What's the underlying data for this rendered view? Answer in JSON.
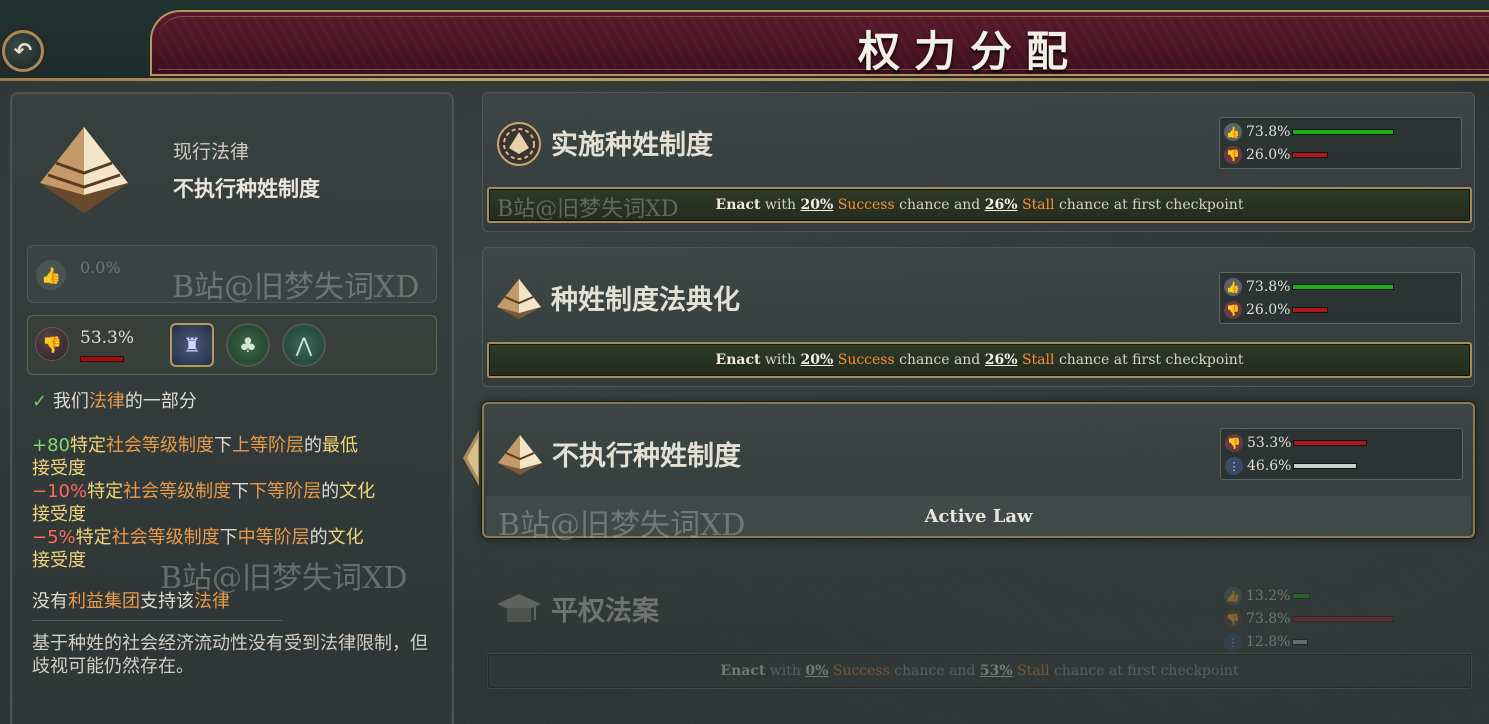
{
  "header": {
    "title": "权力分配",
    "back_icon": "back-arrow-icon"
  },
  "watermark": "B站@旧梦失词XD",
  "left_panel": {
    "current_law_label": "现行法律",
    "current_law_name": "不执行种姓制度",
    "support_pct": "0.0%",
    "oppose_pct": "53.3%",
    "oppose_level": 0.533,
    "interest_groups": [
      "rural-folk-icon",
      "landowners-icon",
      "devout-icon"
    ],
    "part_of_laws": {
      "prefix": "我们",
      "word": "法律",
      "suffix": "的一部分"
    },
    "effects": [
      {
        "value": "+80",
        "a": "特定",
        "b": "社会等级制度",
        "c": "下",
        "d": "上等阶层",
        "e": "的",
        "f": "最低",
        "g": "接受度"
      },
      {
        "value": "−10%",
        "a": "特定",
        "b": "社会等级制度",
        "c": "下",
        "d": "下等阶层",
        "e": "的",
        "f": "文化",
        "g": "接受度"
      },
      {
        "value": "−5%",
        "a": "特定",
        "b": "社会等级制度",
        "c": "下",
        "d": "中等阶层",
        "e": "的",
        "f": "文化",
        "g": "接受度"
      }
    ],
    "no_support": {
      "a": "没有",
      "b": "利益集团",
      "c": "支持该",
      "d": "法律"
    },
    "description": "基于种姓的社会经济流动性没有受到法律限制，但歧视可能仍然存在。"
  },
  "laws": [
    {
      "title": "实施种姓制度",
      "icon": "chain-icon",
      "support": "73.8%",
      "oppose": "26.0%",
      "enact": {
        "enact_word": "Enact",
        "with": "with",
        "success_pct": "20%",
        "success_word": "Success",
        "mid": "chance and",
        "stall_pct": "26%",
        "stall_word": "Stall",
        "tail": "chance at first checkpoint"
      }
    },
    {
      "title": "种姓制度法典化",
      "icon": "pyramid-icon",
      "support": "73.8%",
      "oppose": "26.0%",
      "enact": {
        "enact_word": "Enact",
        "with": "with",
        "success_pct": "20%",
        "success_word": "Success",
        "mid": "chance and",
        "stall_pct": "26%",
        "stall_word": "Stall",
        "tail": "chance at first checkpoint"
      }
    },
    {
      "title": "不执行种姓制度",
      "icon": "pyramid-icon",
      "oppose": "53.3%",
      "neutral": "46.6%",
      "active_label": "Active Law"
    },
    {
      "title": "平权法案",
      "icon": "mortarboard-icon",
      "support": "13.2%",
      "oppose": "73.8%",
      "neutral": "12.8%",
      "enact": {
        "enact_word": "Enact",
        "with": "with",
        "success_pct": "0%",
        "success_word": "Success",
        "mid": "chance and",
        "stall_pct": "53%",
        "stall_word": "Stall",
        "tail": "chance at first checkpoint"
      }
    }
  ],
  "colors": {
    "accent_gold": "#a88c58",
    "support_green": "#18b018",
    "oppose_red": "#b01818",
    "banner_wine": "#4a1424"
  }
}
